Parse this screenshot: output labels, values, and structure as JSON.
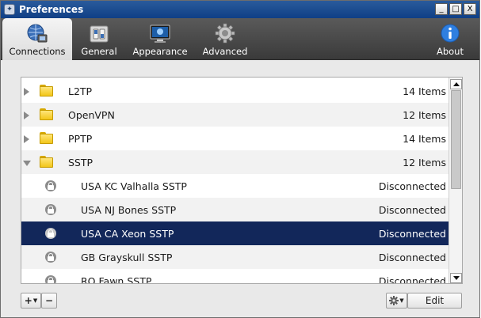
{
  "window": {
    "title": "Preferences",
    "controls": {
      "minimize": "_",
      "maximize": "□",
      "close": "X"
    }
  },
  "toolbar": {
    "tabs": [
      {
        "label": "Connections",
        "icon": "globe-network-icon",
        "active": true
      },
      {
        "label": "General",
        "icon": "switch-panel-icon",
        "active": false
      },
      {
        "label": "Appearance",
        "icon": "monitor-icon",
        "active": false
      },
      {
        "label": "Advanced",
        "icon": "gear-icon",
        "active": false
      }
    ],
    "about": {
      "label": "About",
      "icon": "info-icon"
    }
  },
  "list": {
    "groups": [
      {
        "name": "L2TP",
        "count": "14 Items",
        "expanded": false
      },
      {
        "name": "OpenVPN",
        "count": "12 Items",
        "expanded": false
      },
      {
        "name": "PPTP",
        "count": "14 Items",
        "expanded": false
      },
      {
        "name": "SSTP",
        "count": "12 Items",
        "expanded": true
      }
    ],
    "connections": [
      {
        "name": "USA KC Valhalla SSTP",
        "status": "Disconnected",
        "selected": false
      },
      {
        "name": "USA NJ Bones SSTP",
        "status": "Disconnected",
        "selected": false
      },
      {
        "name": "USA CA Xeon SSTP",
        "status": "Disconnected",
        "selected": true
      },
      {
        "name": "GB Grayskull SSTP",
        "status": "Disconnected",
        "selected": false
      },
      {
        "name": "RO Fawn SSTP",
        "status": "Disconnected",
        "selected": false
      }
    ]
  },
  "bottom": {
    "add_label": "+",
    "remove_label": "−",
    "edit_label": "Edit"
  },
  "colors": {
    "selection": "#12275a",
    "toolbar": "#4a4a4a",
    "titlebar": "#1a4a8f"
  }
}
